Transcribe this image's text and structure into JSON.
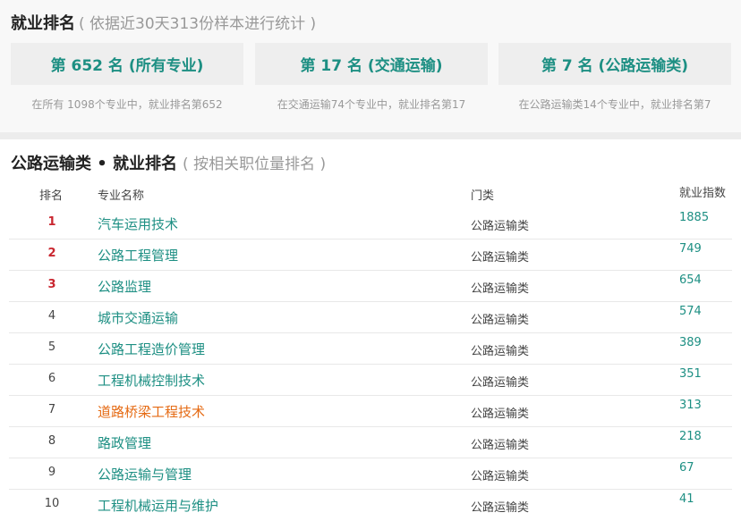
{
  "section1": {
    "title": "就业排名",
    "subtitle": "( 依据近30天313份样本进行统计 )",
    "cards": [
      {
        "label": "第 652 名 (所有专业)",
        "caption": "在所有 1098个专业中，就业排名第652"
      },
      {
        "label": "第 17 名 (交通运输)",
        "caption": "在交通运输74个专业中，就业排名第17"
      },
      {
        "label": "第 7 名 (公路运输类)",
        "caption": "在公路运输类14个专业中，就业排名第7"
      }
    ]
  },
  "section2": {
    "title": "公路运输类 • 就业排名",
    "subtitle": "( 按相关职位量排名 )",
    "headers": {
      "rank": "排名",
      "name": "专业名称",
      "category": "门类",
      "index": "就业指数"
    },
    "rows": [
      {
        "rank": "1",
        "name": "汽车运用技术",
        "category": "公路运输类",
        "index": "1885"
      },
      {
        "rank": "2",
        "name": "公路工程管理",
        "category": "公路运输类",
        "index": "749"
      },
      {
        "rank": "3",
        "name": "公路监理",
        "category": "公路运输类",
        "index": "654"
      },
      {
        "rank": "4",
        "name": "城市交通运输",
        "category": "公路运输类",
        "index": "574"
      },
      {
        "rank": "5",
        "name": "公路工程造价管理",
        "category": "公路运输类",
        "index": "389"
      },
      {
        "rank": "6",
        "name": "工程机械控制技术",
        "category": "公路运输类",
        "index": "351"
      },
      {
        "rank": "7",
        "name": "道路桥梁工程技术",
        "category": "公路运输类",
        "index": "313",
        "highlighted": true
      },
      {
        "rank": "8",
        "name": "路政管理",
        "category": "公路运输类",
        "index": "218"
      },
      {
        "rank": "9",
        "name": "公路运输与管理",
        "category": "公路运输类",
        "index": "67"
      },
      {
        "rank": "10",
        "name": "工程机械运用与维护",
        "category": "公路运输类",
        "index": "41"
      }
    ]
  },
  "colors": {
    "accent": "#1d8f83",
    "top_rank": "#c9262f",
    "highlight": "#e56a13",
    "muted": "#999999"
  }
}
